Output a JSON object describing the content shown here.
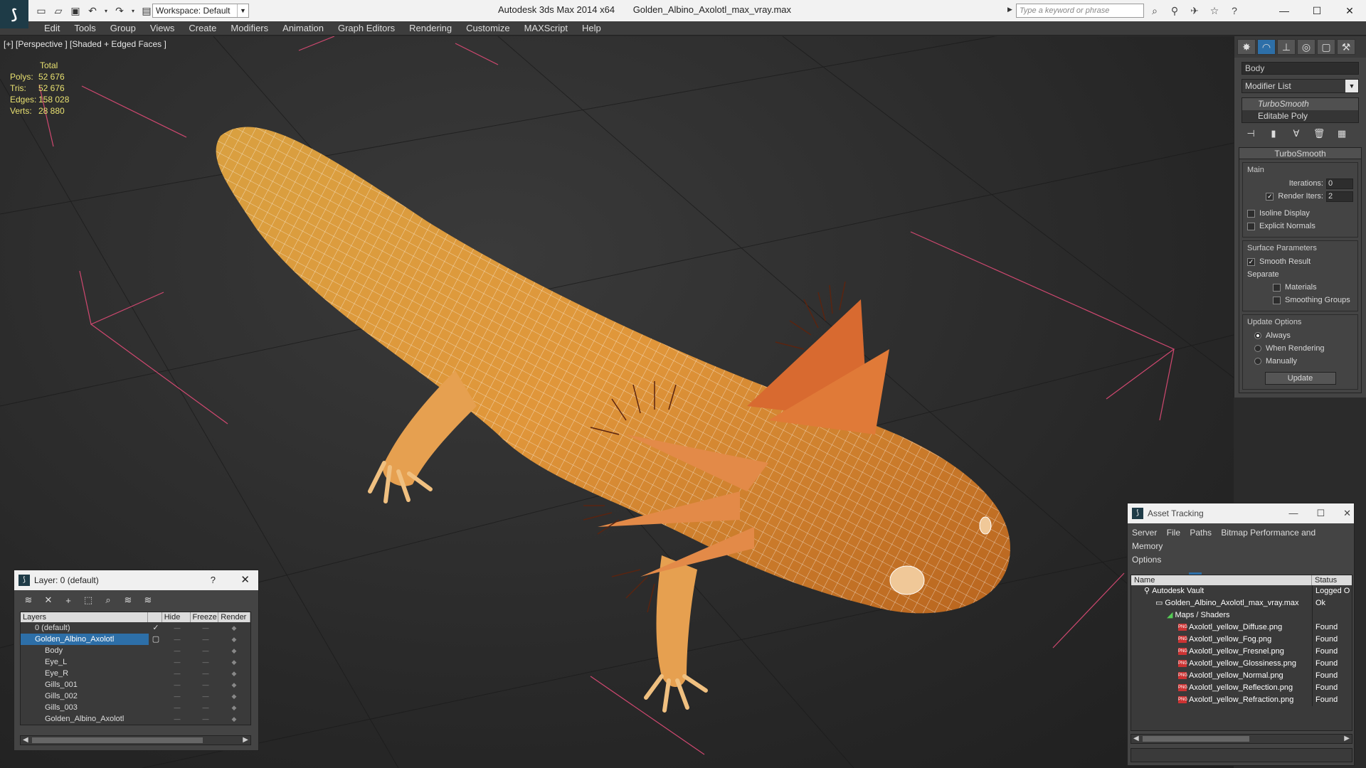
{
  "titlebar": {
    "workspace": "Workspace: Default",
    "app_name": "Autodesk 3ds Max 2014 x64",
    "file_name": "Golden_Albino_Axolotl_max_vray.max",
    "search_placeholder": "Type a keyword or phrase"
  },
  "menu": [
    "Edit",
    "Tools",
    "Group",
    "Views",
    "Create",
    "Modifiers",
    "Animation",
    "Graph Editors",
    "Rendering",
    "Customize",
    "MAXScript",
    "Help"
  ],
  "viewport": {
    "label": "[+] [Perspective ] [Shaded + Edged Faces ]",
    "stats": {
      "total_label": "Total",
      "rows": [
        {
          "k": "Polys:",
          "v": "52 676"
        },
        {
          "k": "Tris:",
          "v": "52 676"
        },
        {
          "k": "Edges:",
          "v": "158 028"
        },
        {
          "k": "Verts:",
          "v": "28 880"
        }
      ]
    }
  },
  "command_panel": {
    "object_name": "Body",
    "modifier_list": "Modifier List",
    "stack": [
      "TurboSmooth",
      "Editable Poly"
    ],
    "rollout_title": "TurboSmooth",
    "main_group": "Main",
    "iterations_label": "Iterations:",
    "iterations_value": "0",
    "render_iters_label": "Render Iters:",
    "render_iters_value": "2",
    "isoline": "Isoline Display",
    "explicit_normals": "Explicit Normals",
    "surface_group": "Surface Parameters",
    "smooth_result": "Smooth Result",
    "separate": "Separate",
    "materials": "Materials",
    "smoothing_groups": "Smoothing Groups",
    "update_group": "Update Options",
    "always": "Always",
    "when_rendering": "When Rendering",
    "manually": "Manually",
    "update_button": "Update"
  },
  "layer_window": {
    "title": "Layer: 0 (default)",
    "help": "?",
    "columns": [
      "Layers",
      "Hide",
      "Freeze",
      "Render"
    ],
    "rows": [
      {
        "name": "0 (default)",
        "indent": 1,
        "selected": false
      },
      {
        "name": "Golden_Albino_Axolotl",
        "indent": 1,
        "selected": true
      },
      {
        "name": "Body",
        "indent": 2,
        "selected": false
      },
      {
        "name": "Eye_L",
        "indent": 2,
        "selected": false
      },
      {
        "name": "Eye_R",
        "indent": 2,
        "selected": false
      },
      {
        "name": "Gills_001",
        "indent": 2,
        "selected": false
      },
      {
        "name": "Gills_002",
        "indent": 2,
        "selected": false
      },
      {
        "name": "Gills_003",
        "indent": 2,
        "selected": false
      },
      {
        "name": "Golden_Albino_Axolotl",
        "indent": 2,
        "selected": false
      }
    ]
  },
  "asset_tracking": {
    "title": "Asset Tracking",
    "menu": [
      "Server",
      "File",
      "Paths",
      "Bitmap Performance and Memory",
      "Options"
    ],
    "columns": [
      "Name",
      "Status"
    ],
    "rows": [
      {
        "name": "Autodesk Vault",
        "status": "Logged O",
        "indent": 1,
        "kind": "vault"
      },
      {
        "name": "Golden_Albino_Axolotl_max_vray.max",
        "status": "Ok",
        "indent": 2,
        "kind": "file"
      },
      {
        "name": "Maps / Shaders",
        "status": "",
        "indent": 3,
        "kind": "folder"
      },
      {
        "name": "Axolotl_yellow_Diffuse.png",
        "status": "Found",
        "indent": 4,
        "kind": "png"
      },
      {
        "name": "Axolotl_yellow_Fog.png",
        "status": "Found",
        "indent": 4,
        "kind": "png"
      },
      {
        "name": "Axolotl_yellow_Fresnel.png",
        "status": "Found",
        "indent": 4,
        "kind": "png"
      },
      {
        "name": "Axolotl_yellow_Glossiness.png",
        "status": "Found",
        "indent": 4,
        "kind": "png"
      },
      {
        "name": "Axolotl_yellow_Normal.png",
        "status": "Found",
        "indent": 4,
        "kind": "png"
      },
      {
        "name": "Axolotl_yellow_Reflection.png",
        "status": "Found",
        "indent": 4,
        "kind": "png"
      },
      {
        "name": "Axolotl_yellow_Refraction.png",
        "status": "Found",
        "indent": 4,
        "kind": "png"
      }
    ]
  }
}
